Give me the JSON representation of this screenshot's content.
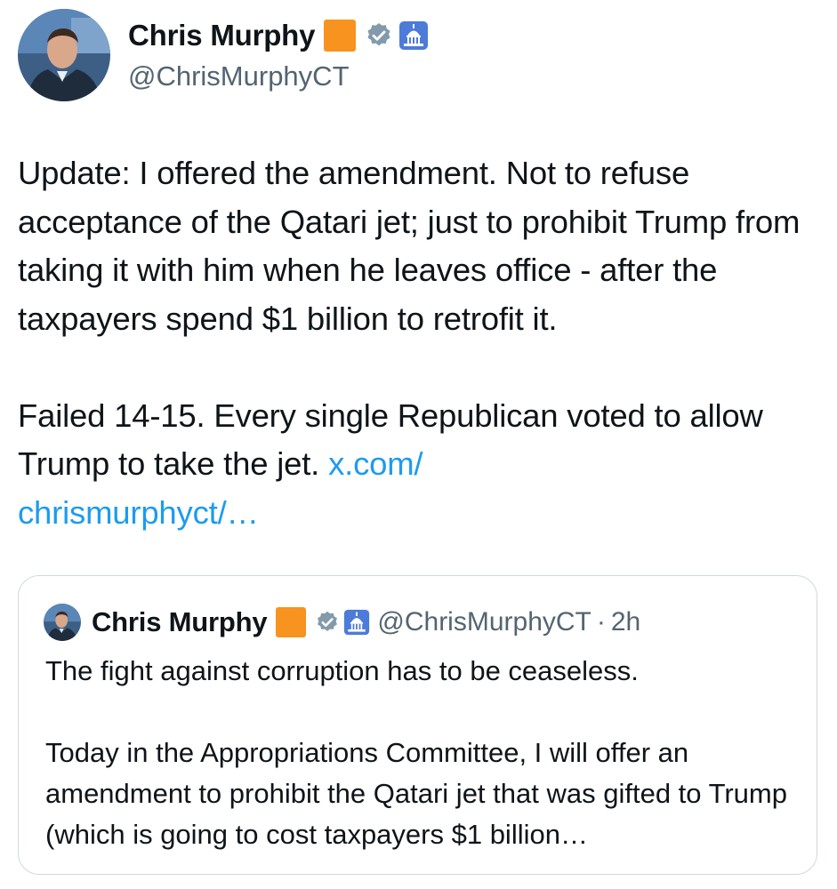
{
  "author": {
    "name": "Chris Murphy",
    "handle": "@ChrisMurphyCT",
    "badges": [
      "orange-square-emoji",
      "verified-gray-icon",
      "capitol-building-icon"
    ],
    "colors": {
      "flag": "#f7931e",
      "verified": "#829aab",
      "capitol_bg": "#4c7bd9"
    }
  },
  "tweet": {
    "text": "Update: I offered the amendment. Not to refuse acceptance of the Qatari jet; just to prohibit Trump from taking it with him when he leaves office - after the taxpayers spend $1 billion to retrofit it.\n\nFailed 14-15. Every single Republican voted to allow Trump to take the jet. ",
    "link": "x.com/\nchrismurphyct/…",
    "link_color": "#1d9bf0"
  },
  "quoted_tweet": {
    "name": "Chris Murphy",
    "handle": "@ChrisMurphyCT",
    "separator": "·",
    "time": "2h",
    "text": "The fight against corruption has to be ceaseless.\n\nToday in the Appropriations Committee, I will offer an amendment to prohibit the Qatari jet that was gifted to Trump (which is going to cost taxpayers $1 billion…"
  }
}
